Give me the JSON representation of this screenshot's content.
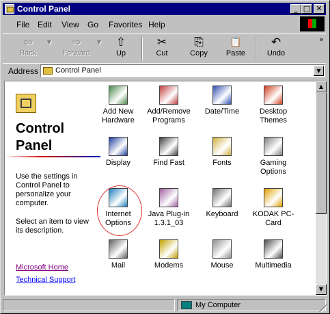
{
  "window": {
    "title": "Control Panel"
  },
  "title_buttons": {
    "minimize": "_",
    "maximize": "□",
    "close": "✕"
  },
  "menu": [
    {
      "label": "File"
    },
    {
      "label": "Edit"
    },
    {
      "label": "View"
    },
    {
      "label": "Go"
    },
    {
      "label": "Favorites"
    },
    {
      "label": "Help"
    }
  ],
  "toolbar": {
    "back": {
      "label": "Back",
      "icon": "back-arrow-icon",
      "glyph": "⇦"
    },
    "forward": {
      "label": "Forward",
      "icon": "forward-arrow-icon",
      "glyph": "⇨"
    },
    "up": {
      "label": "Up",
      "icon": "up-folder-icon",
      "glyph": "⇧"
    },
    "cut": {
      "label": "Cut",
      "icon": "scissors-icon",
      "glyph": "✂"
    },
    "copy": {
      "label": "Copy",
      "icon": "copy-icon",
      "glyph": "⎘"
    },
    "paste": {
      "label": "Paste",
      "icon": "paste-icon",
      "glyph": "📋"
    },
    "undo": {
      "label": "Undo",
      "icon": "undo-icon",
      "glyph": "↶"
    },
    "more": "»"
  },
  "address": {
    "label": "Address",
    "value": "Control Panel"
  },
  "left_panel": {
    "heading": "Control Panel",
    "description": "Use the settings in Control Panel to personalize your computer.",
    "hint": "Select an item to view its description.",
    "links": [
      "Microsoft Home",
      "Technical Support"
    ]
  },
  "items": [
    {
      "label": "Add New Hardware",
      "icon": "hardware-icon",
      "color": "#4a8a4a"
    },
    {
      "label": "Add/Remove Programs",
      "icon": "programs-icon",
      "color": "#c04040"
    },
    {
      "label": "Date/Time",
      "icon": "clock-calendar-icon",
      "color": "#3050b0"
    },
    {
      "label": "Desktop Themes",
      "icon": "themes-icon",
      "color": "#d04020"
    },
    {
      "label": "Display",
      "icon": "monitor-icon",
      "color": "#2040a0"
    },
    {
      "label": "Find Fast",
      "icon": "binoculars-icon",
      "color": "#404040"
    },
    {
      "label": "Fonts",
      "icon": "fonts-folder-icon",
      "color": "#d0b040"
    },
    {
      "label": "Gaming Options",
      "icon": "joystick-icon",
      "color": "#808080"
    },
    {
      "label": "Internet Options",
      "icon": "globe-icon",
      "color": "#2080c0"
    },
    {
      "label": "Java Plug-in 1.3.1_03",
      "icon": "java-icon",
      "color": "#a060a0"
    },
    {
      "label": "Keyboard",
      "icon": "keyboard-icon",
      "color": "#707070"
    },
    {
      "label": "KODAK PC-Card",
      "icon": "kodak-icon",
      "color": "#e0a000"
    },
    {
      "label": "Mail",
      "icon": "mail-icon",
      "color": "#606060"
    },
    {
      "label": "Modems",
      "icon": "modem-icon",
      "color": "#c0a000"
    },
    {
      "label": "Mouse",
      "icon": "mouse-icon",
      "color": "#909090"
    },
    {
      "label": "Multimedia",
      "icon": "multimedia-icon",
      "color": "#505050"
    }
  ],
  "status": {
    "location": "My Computer"
  }
}
